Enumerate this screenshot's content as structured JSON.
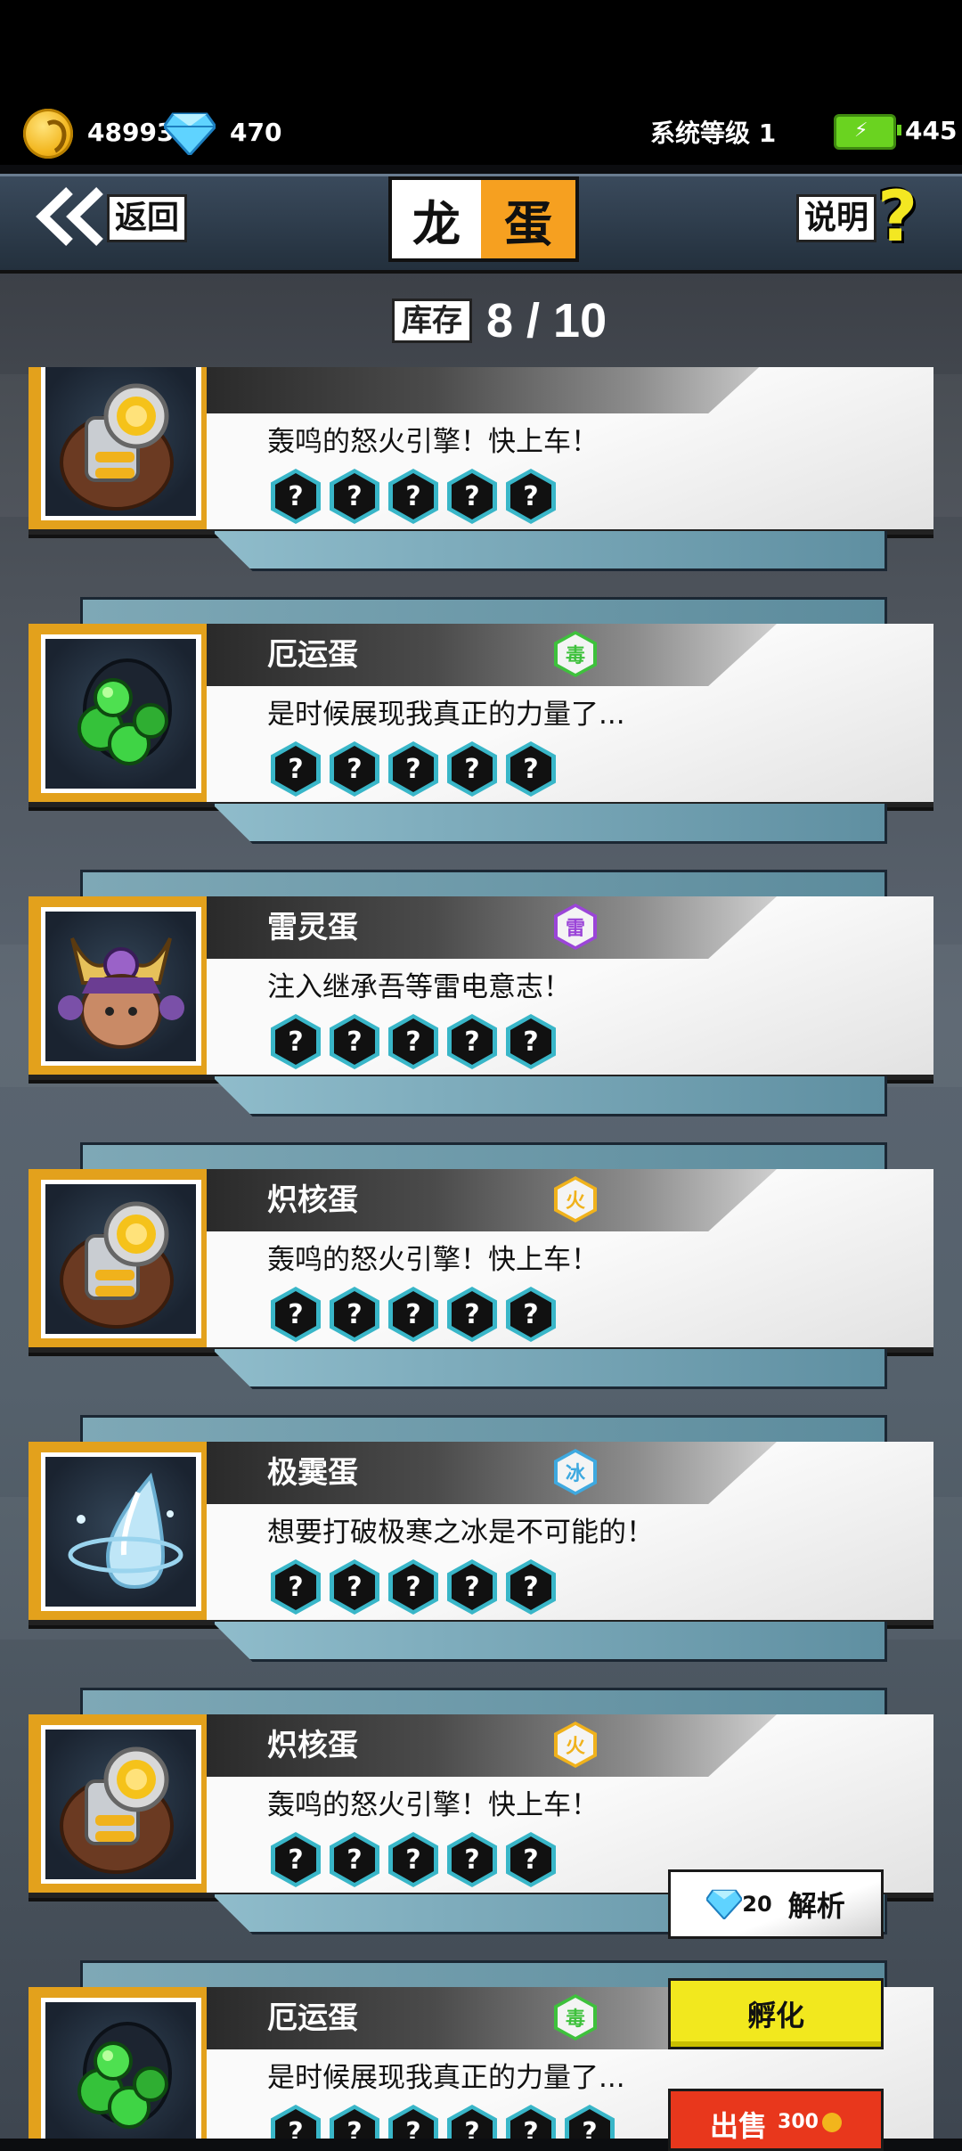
{
  "status": {
    "coins": "48993",
    "gems": "470",
    "system_level": "系统等级 1",
    "energy": "445"
  },
  "header": {
    "back_label": "返回",
    "title_left": "龙",
    "title_right": "蛋",
    "help_label": "说明",
    "help_icon": "?"
  },
  "stock": {
    "label": "库存",
    "value": "8 / 10"
  },
  "eggs": [
    {
      "name": "",
      "element": "",
      "desc": "轰鸣的怒火引擎！快上车！",
      "icon": "engine-egg-icon"
    },
    {
      "name": "厄运蛋",
      "element": "毒",
      "element_color": "#3ec13c",
      "desc": "是时候展现我真正的力量了...",
      "icon": "doom-egg-icon"
    },
    {
      "name": "雷灵蛋",
      "element": "雷",
      "element_color": "#9b45d8",
      "desc": "注入继承吾等雷电意志！",
      "icon": "thunder-egg-icon"
    },
    {
      "name": "炽核蛋",
      "element": "火",
      "element_color": "#f0b21c",
      "desc": "轰鸣的怒火引擎！快上车！",
      "icon": "engine-egg-icon"
    },
    {
      "name": "极霙蛋",
      "element": "冰",
      "element_color": "#3ea9e0",
      "desc": "想要打破极寒之冰是不可能的！",
      "icon": "ice-egg-icon"
    },
    {
      "name": "炽核蛋",
      "element": "火",
      "element_color": "#f0b21c",
      "desc": "轰鸣的怒火引擎！快上车！",
      "icon": "engine-egg-icon"
    },
    {
      "name": "厄运蛋",
      "element": "毒",
      "element_color": "#3ec13c",
      "desc": "是时候展现我真正的力量了...",
      "icon": "doom-egg-icon"
    }
  ],
  "slot_symbol": "?",
  "actions": {
    "analyze_cost": "20",
    "analyze_label": "解析",
    "hatch_label": "孵化",
    "sell_label": "出售",
    "sell_price": "300"
  }
}
